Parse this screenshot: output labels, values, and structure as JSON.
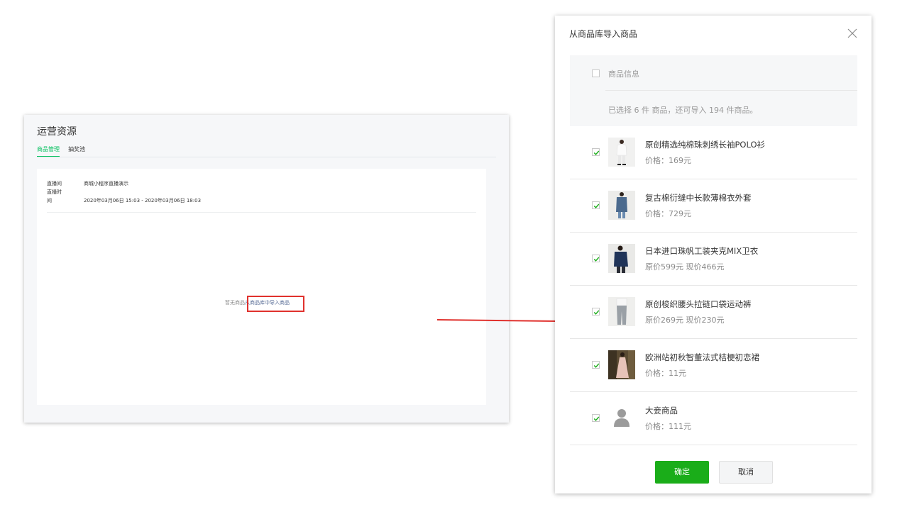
{
  "left_panel": {
    "title": "运营资源",
    "tabs": [
      {
        "label": "商品管理",
        "active": true
      },
      {
        "label": "抽奖池",
        "active": false
      }
    ],
    "live_room_label": "直播间",
    "live_room_value": "商城小程序直播演示",
    "live_time_label_1": "直播时",
    "live_time_label_2": "间",
    "live_time_value": "2020年03月06日 15:03 - 2020年03月06日 18:03",
    "empty_text": "暂无商品",
    "import_link": "从商品库中导入商品"
  },
  "dialog": {
    "title": "从商品库导入商品",
    "header_label": "商品信息",
    "selection_info": "已选择 6 件 商品，还可导入 194 件商品。",
    "products": [
      {
        "name": "原创精选纯棉珠刺绣长袖POLO衫",
        "price": "价格：169元",
        "checked": true,
        "thumb": "white-shirt"
      },
      {
        "name": "复古棉衍缝中长款薄棉衣外套",
        "price": "价格：729元",
        "checked": true,
        "thumb": "denim-coat"
      },
      {
        "name": "日本进口珠帆工装夹克MIX卫衣",
        "price": "原价599元 现价466元",
        "checked": true,
        "thumb": "navy-jacket"
      },
      {
        "name": "原创梭织腰头拉链口袋运动裤",
        "price": "原价269元 现价230元",
        "checked": true,
        "thumb": "grey-pants"
      },
      {
        "name": "欧洲站初秋智董法式桔梗初恋裙",
        "price": "价格：11元",
        "checked": true,
        "thumb": "dress"
      },
      {
        "name": "大妾商品",
        "price": "价格：111元",
        "checked": true,
        "thumb": "avatar-placeholder"
      }
    ],
    "confirm_label": "确定",
    "cancel_label": "取消"
  },
  "colors": {
    "wechat_green": "#1aad19",
    "tab_green": "#07c160",
    "link_blue": "#576b95",
    "highlight_red": "#e0312d"
  }
}
